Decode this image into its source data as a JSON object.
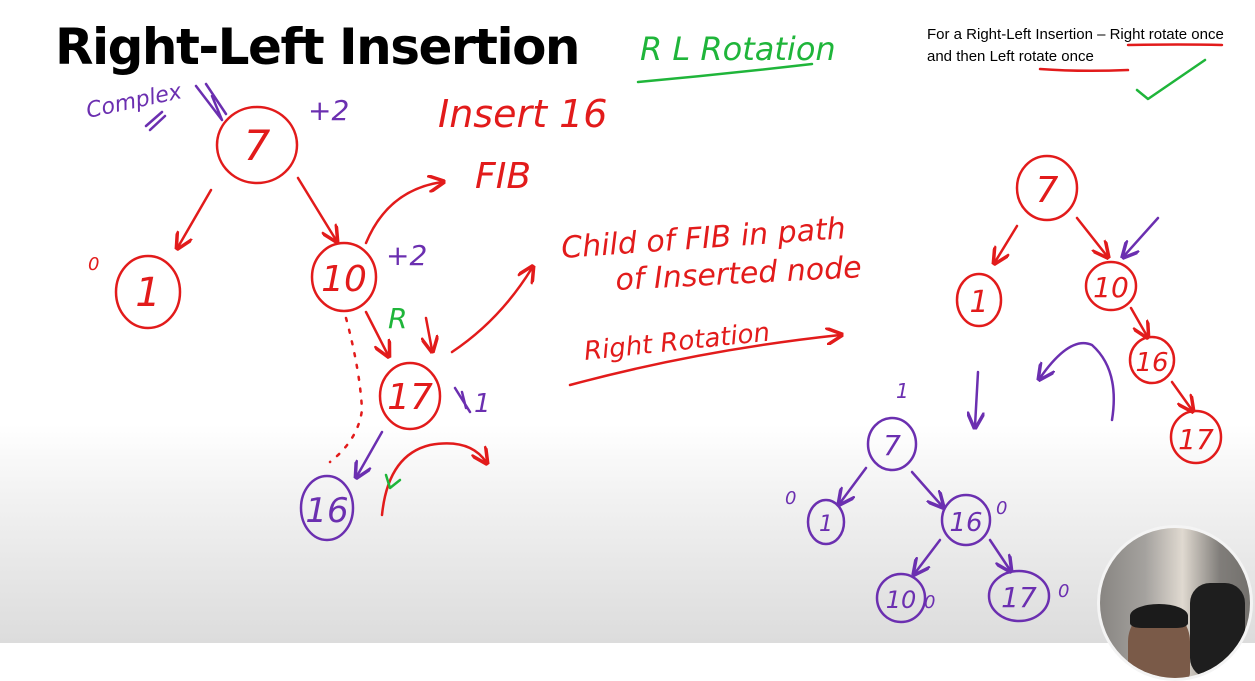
{
  "slide": {
    "title": "Right-Left Insertion",
    "rule_note_part1": "For a Right-Left Insertion – ",
    "rule_note_right": "Right rotate",
    "rule_note_part2": " once and then ",
    "rule_note_left": "Left rotate",
    "rule_note_part3": " once"
  },
  "annotations": {
    "heading_rl": "R L Rotation",
    "complex": "Complex",
    "insert": "Insert 16",
    "fib": "FIB",
    "child_line1": "Child of FIB in path",
    "child_line2": "of Inserted node",
    "right_rotation": "Right Rotation",
    "r_mark": "R",
    "bf_root": "+2",
    "bf_ten": "+2",
    "bf_seventeen": "1",
    "bf_one": "0",
    "bf_seven_final": "1",
    "bf_one_final": "0",
    "bf_sixteen_final": "0",
    "bf_ten_final": "0",
    "bf_seventeen_final": "0"
  },
  "trees": {
    "original": {
      "root": "7",
      "left": "1",
      "right": "10",
      "right_child": "17",
      "inserted": "16"
    },
    "after_right_rotation": {
      "root": "7",
      "left": "1",
      "right": "10",
      "right_child": "16",
      "grandchild": "17"
    },
    "balanced": {
      "root": "7",
      "left": "1",
      "right": "16",
      "right_left": "10",
      "right_right": "17"
    }
  },
  "colors": {
    "ink_red": "#e21b1b",
    "ink_purple": "#6b2fb0",
    "ink_green": "#1fb53a"
  }
}
